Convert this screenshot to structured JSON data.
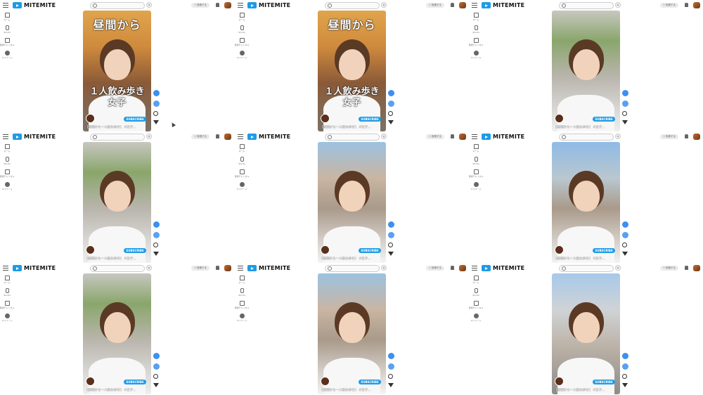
{
  "header": {
    "logo_text": "MITEMITE",
    "upload_label": "+ 投稿する",
    "brand_color": "#1e9be6"
  },
  "sidebar": {
    "items": [
      {
        "icon": "home-icon",
        "label": "ホーム"
      },
      {
        "icon": "shorts-icon",
        "label": "Shorts"
      },
      {
        "icon": "subscriptions-icon",
        "label": "登録チャンネル"
      },
      {
        "icon": "you-icon",
        "label": "マイページ"
      }
    ]
  },
  "video": {
    "overlay_title": "昼間から",
    "overlay_sub_line1": "１人飲み歩き",
    "overlay_sub_line2": "女子",
    "subscribe_label": "SUBSCRIBE",
    "caption": "【昼間から一人飲み歩き】 #女子…"
  },
  "frames": [
    {
      "scene": "v1",
      "show_text_overlay": true
    },
    {
      "scene": "v1",
      "show_text_overlay": true
    },
    {
      "scene": "v2",
      "show_text_overlay": false
    },
    {
      "scene": "v2",
      "show_text_overlay": false
    },
    {
      "scene": "v3",
      "show_text_overlay": false
    },
    {
      "scene": "v4",
      "show_text_overlay": false
    },
    {
      "scene": "v2",
      "show_text_overlay": false
    },
    {
      "scene": "v3",
      "show_text_overlay": false
    },
    {
      "scene": "v5",
      "show_text_overlay": false
    }
  ]
}
